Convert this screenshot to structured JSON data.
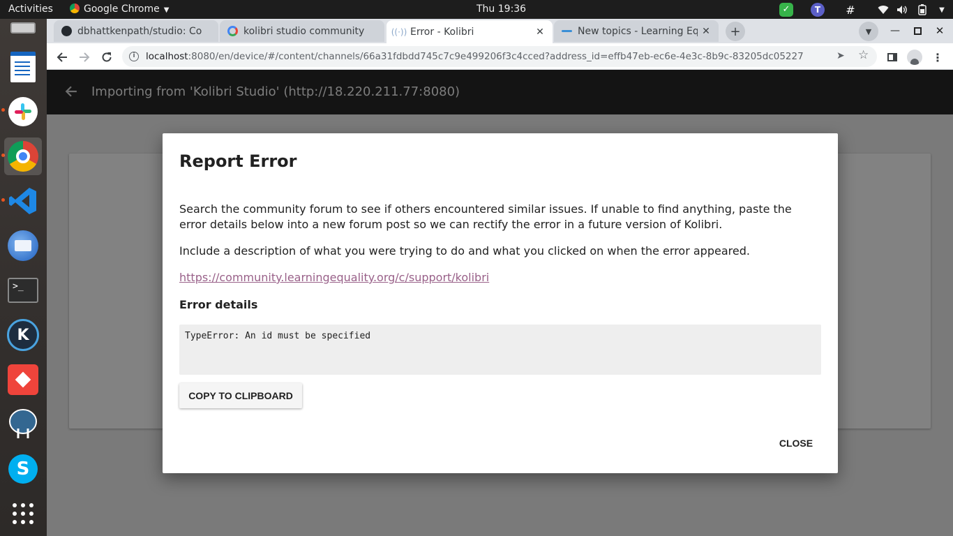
{
  "system": {
    "activities": "Activities",
    "app_name": "Google Chrome",
    "clock": "Thu 19:36"
  },
  "dock": {
    "items": [
      "files",
      "writer",
      "slack",
      "chrome",
      "vscode",
      "thunderbird",
      "terminal",
      "kolibri",
      "anydesk",
      "postgres",
      "skype",
      "show-apps"
    ]
  },
  "browser": {
    "tabs": [
      {
        "title": "dbhattkenpath/studio: Co",
        "favicon": "github-icon"
      },
      {
        "title": "kolibri studio community",
        "favicon": "google-icon"
      },
      {
        "title": "Error - Kolibri",
        "favicon": "kolibri-icon"
      },
      {
        "title": "New topics - Learning Equ",
        "favicon": "learning-equality-icon"
      }
    ],
    "active_tab": 2,
    "url_host": "localhost",
    "url_rest": ":8080/en/device/#/content/channels/66a31fdbdd745c7c9e499206f3c4cced?address_id=effb47eb-ec6e-4e3c-8b9c-83205dc05227"
  },
  "page": {
    "appbar_title": "Importing from 'Kolibri Studio' (http://18.220.211.77:8080)"
  },
  "modal": {
    "title": "Report Error",
    "paragraph1": "Search the community forum to see if others encountered similar issues. If unable to find anything, paste the error details below into a new forum post so we can rectify the error in a future version of Kolibri.",
    "paragraph2": "Include a description of what you were trying to do and what you clicked on when the error appeared.",
    "link": "https://community.learningequality.org/c/support/kolibri",
    "details_heading": "Error details",
    "details_text": "TypeError: An id must be specified",
    "copy_label": "COPY TO CLIPBOARD",
    "close_label": "CLOSE"
  },
  "colors": {
    "link": "#996189",
    "appbar": "#141414",
    "scrim": "#7a7a7a"
  }
}
